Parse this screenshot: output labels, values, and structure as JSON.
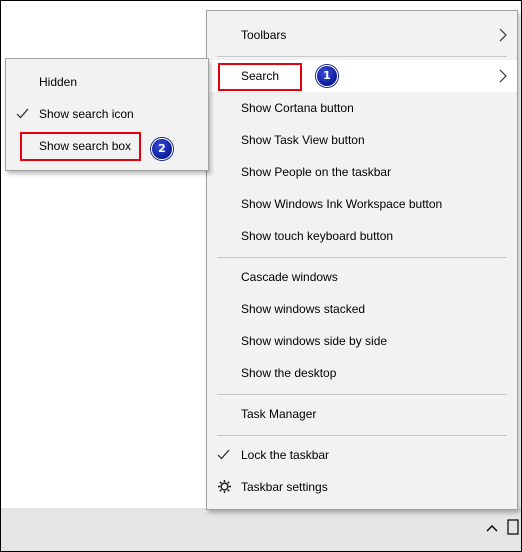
{
  "main_menu": {
    "items": [
      {
        "label": "Toolbars"
      },
      {
        "label": "Search"
      },
      {
        "label": "Show Cortana button"
      },
      {
        "label": "Show Task View button"
      },
      {
        "label": "Show People on the taskbar"
      },
      {
        "label": "Show Windows Ink Workspace button"
      },
      {
        "label": "Show touch keyboard button"
      },
      {
        "label": "Cascade windows"
      },
      {
        "label": "Show windows stacked"
      },
      {
        "label": "Show windows side by side"
      },
      {
        "label": "Show the desktop"
      },
      {
        "label": "Task Manager"
      },
      {
        "label": "Lock the taskbar",
        "checked": true
      },
      {
        "label": "Taskbar settings",
        "icon": "gear-icon"
      }
    ]
  },
  "search_submenu": {
    "items": [
      {
        "label": "Hidden"
      },
      {
        "label": "Show search icon",
        "checked": true
      },
      {
        "label": "Show search box"
      }
    ]
  },
  "annotations": {
    "step1": "1",
    "step2": "2",
    "highlight_color": "#e3000f",
    "badge_color": "#0a1a9a"
  },
  "colors": {
    "menu_background": "#f2f2f2",
    "hover_background": "#ffffff",
    "taskbar": "#e5e5e5"
  }
}
